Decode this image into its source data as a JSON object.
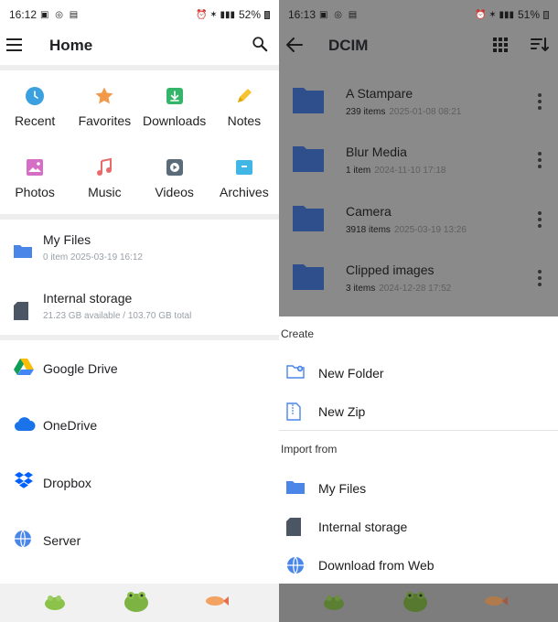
{
  "left": {
    "status": {
      "time": "16:12",
      "battery": "52%"
    },
    "title": "Home",
    "categories": [
      {
        "label": "Recent",
        "icon": "clock-icon",
        "color": "#3aa0e0"
      },
      {
        "label": "Favorites",
        "icon": "star-icon",
        "color": "#f29a4a"
      },
      {
        "label": "Downloads",
        "icon": "download-icon",
        "color": "#34b56a"
      },
      {
        "label": "Notes",
        "icon": "pencil-icon",
        "color": "#f5c430"
      },
      {
        "label": "Photos",
        "icon": "image-icon",
        "color": "#d56fc6"
      },
      {
        "label": "Music",
        "icon": "music-icon",
        "color": "#e96a6a"
      },
      {
        "label": "Videos",
        "icon": "video-icon",
        "color": "#5a6b7a"
      },
      {
        "label": "Archives",
        "icon": "archive-icon",
        "color": "#3fb6e3"
      }
    ],
    "storage": [
      {
        "name": "My Files",
        "sub": "0 item  2025-03-19 16:12"
      },
      {
        "name": "Internal storage",
        "sub": "21.23 GB available / 103.70 GB total"
      }
    ],
    "cloud": [
      {
        "name": "Google Drive"
      },
      {
        "name": "OneDrive"
      },
      {
        "name": "Dropbox"
      },
      {
        "name": "Server"
      }
    ]
  },
  "right": {
    "status": {
      "time": "16:13",
      "battery": "51%"
    },
    "title": "DCIM",
    "folders": [
      {
        "name": "A Stampare",
        "count": "239 items",
        "date": "2025-01-08 08:21"
      },
      {
        "name": "Blur Media",
        "count": "1 item",
        "date": "2024-11-10 17:18"
      },
      {
        "name": "Camera",
        "count": "3918 items",
        "date": "2025-03-19 13:26"
      },
      {
        "name": "Clipped images",
        "count": "3 items",
        "date": "2024-12-28 17:52"
      }
    ],
    "sheet": {
      "create_label": "Create",
      "create_options": [
        {
          "label": "New Folder"
        },
        {
          "label": "New Zip"
        }
      ],
      "import_label": "Import from",
      "import_options": [
        {
          "label": "My Files"
        },
        {
          "label": "Internal storage"
        },
        {
          "label": "Download from Web"
        }
      ]
    }
  },
  "colors": {
    "folder_blue": "#2f4f8c",
    "accent_blue": "#4a86e8",
    "backdrop": "#8a8a8a"
  }
}
